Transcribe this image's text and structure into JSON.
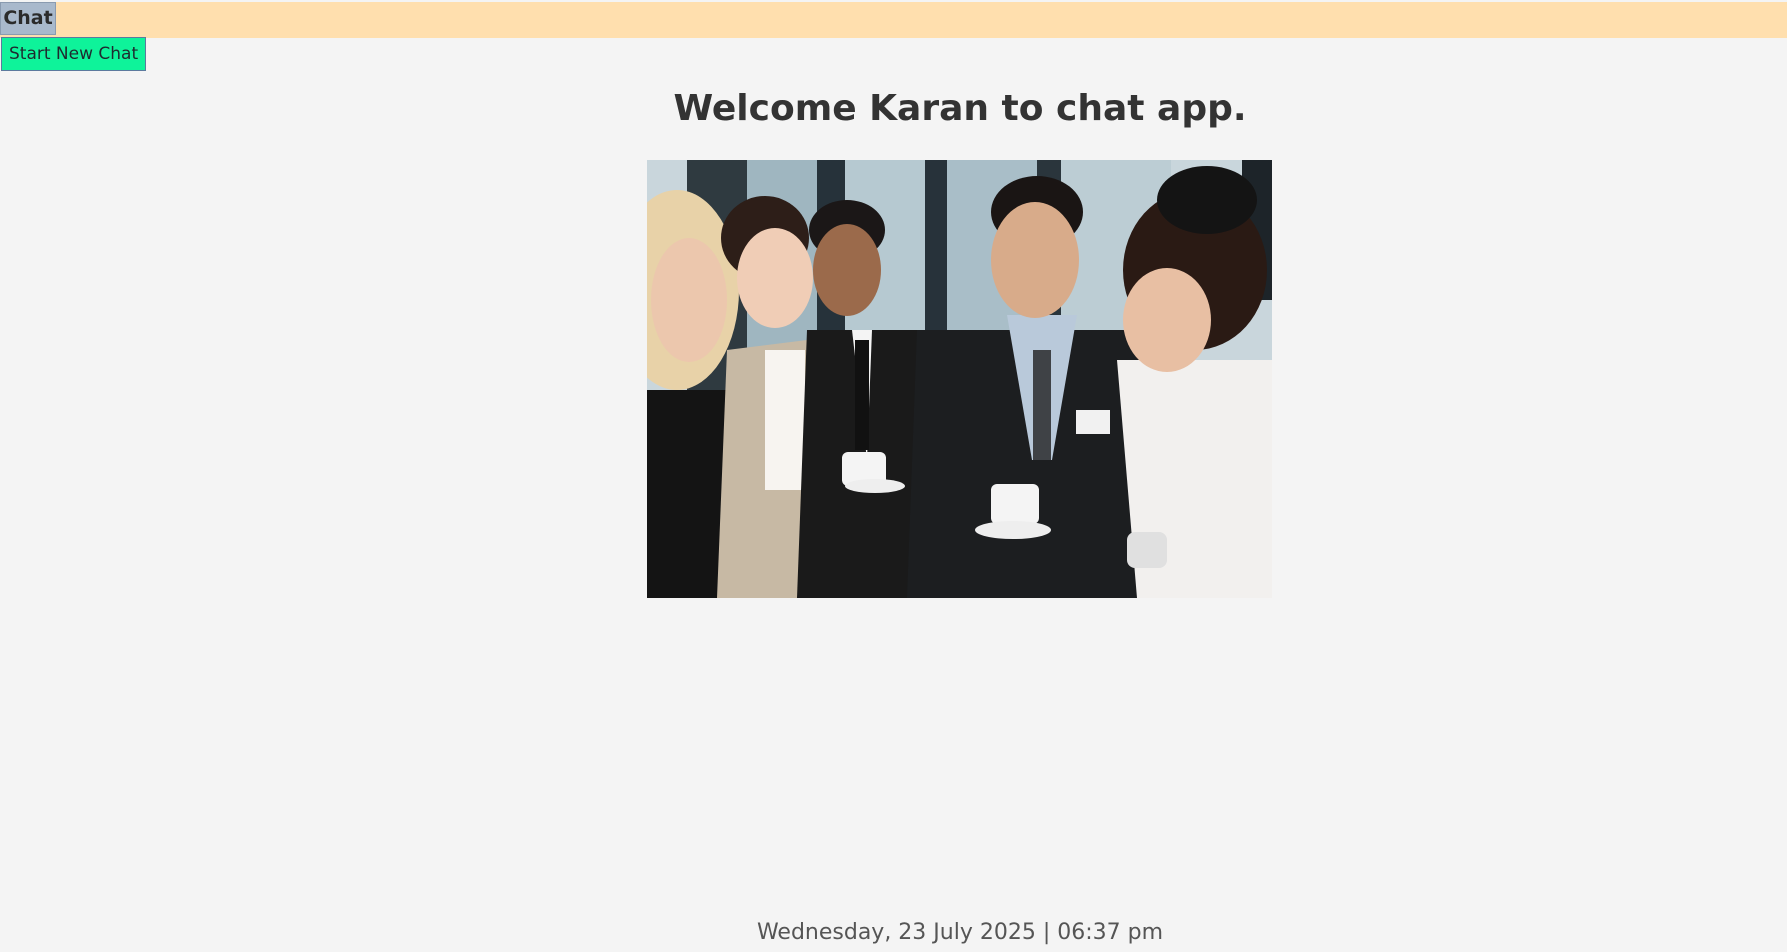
{
  "tabs": {
    "chat_label": "Chat"
  },
  "actions": {
    "new_chat_label": "Start New Chat"
  },
  "main": {
    "welcome_text": "Welcome Karan to chat app.",
    "image_alt": "Group of smiling business people holding coffee cups"
  },
  "footer": {
    "datetime": "Wednesday, 23 July 2025 | 06:37 pm"
  },
  "colors": {
    "topbar": "#ffdfae",
    "tab_active": "#a9b9cc",
    "new_chat_button": "#0ef39a",
    "background": "#f4f4f4"
  }
}
